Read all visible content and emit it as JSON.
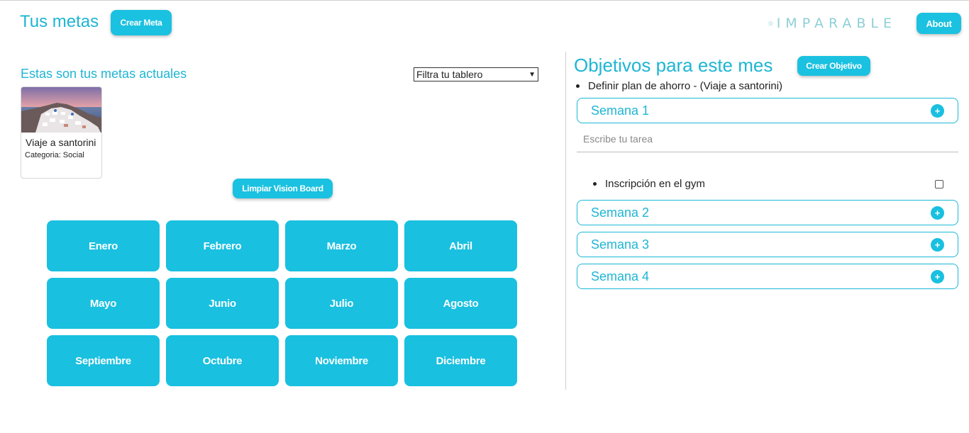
{
  "header": {
    "title": "Tus metas",
    "crear_meta": "Crear Meta",
    "logo_text": "IMPARABLE",
    "about": "About"
  },
  "left": {
    "subtitle": "Estas son tus metas actuales",
    "filter_selected": "Filtra tu tablero",
    "goal_card": {
      "title": "Viaje a santorini",
      "category": "Categoria: Social"
    },
    "limpiar": "Limpiar Vision Board",
    "months": [
      "Enero",
      "Febrero",
      "Marzo",
      "Abril",
      "Mayo",
      "Junio",
      "Julio",
      "Agosto",
      "Septiembre",
      "Octubre",
      "Noviembre",
      "Diciembre"
    ]
  },
  "right": {
    "title": "Objetivos para este mes",
    "crear_objetivo": "Crear Objetivo",
    "objective": "Definir plan de ahorro - (Viaje a santorini)",
    "weeks": [
      "Semana 1",
      "Semana 2",
      "Semana 3",
      "Semana 4"
    ],
    "task_placeholder": "Escribe tu tarea",
    "task": "Inscripción en el gym"
  },
  "colors": {
    "accent": "#1bc1e0",
    "title_text": "#1fb5d4"
  }
}
